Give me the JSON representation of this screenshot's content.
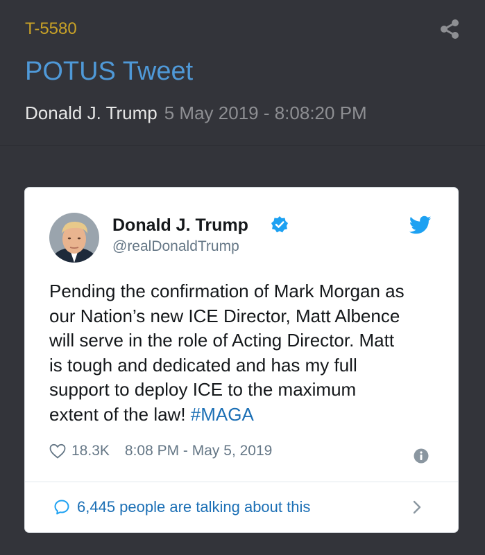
{
  "header": {
    "ref_id": "T-5580",
    "title": "POTUS Tweet",
    "author": "Donald J. Trump",
    "timestamp": "5 May 2019 - 8:08:20 PM"
  },
  "tweet": {
    "name": "Donald J. Trump",
    "handle": "@realDonaldTrump",
    "text": "Pending the confirmation of Mark Morgan as\nour Nation’s new ICE Director, Matt Albence\nwill serve in the role of Acting Director. Matt\nis tough and dedicated and has my full\nsupport to deploy ICE to the maximum\nextent of the law! ",
    "hashtag": "#MAGA",
    "likes": "18.3K",
    "date": "8:08 PM - May 5, 2019",
    "conversation": "6,445 people are talking about this"
  },
  "icons": {
    "share": "share-icon",
    "verified": "verified-badge-icon",
    "twitter": "twitter-bird-icon",
    "heart": "heart-icon",
    "info": "info-icon",
    "bubble": "speech-bubble-icon",
    "chevron": "chevron-right-icon"
  },
  "colors": {
    "background": "#33343a",
    "ref_id": "#c9a227",
    "title": "#4f99d8",
    "twitter_blue": "#1da1f2",
    "link": "#1b6fb5"
  }
}
